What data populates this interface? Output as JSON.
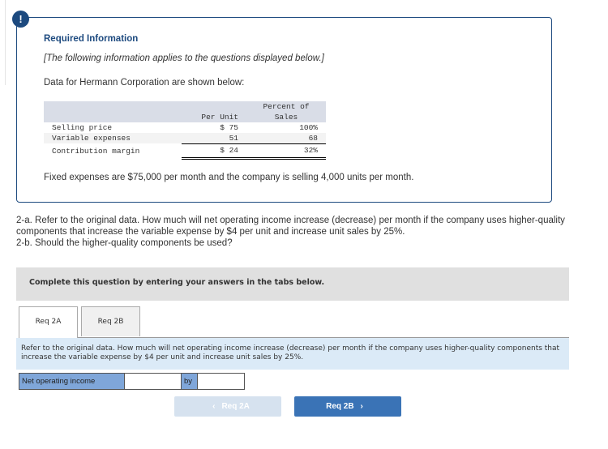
{
  "info": {
    "alert_icon": "!",
    "title": "Required Information",
    "note": "[The following information applies to the questions displayed below.]",
    "intro": "Data for Hermann Corporation are shown below:",
    "table": {
      "headers": {
        "per_unit": "Per Unit",
        "percent_line1": "Percent of",
        "percent_line2": "Sales"
      },
      "rows": [
        {
          "label": "Selling price",
          "per_unit": "$ 75",
          "percent": "100%"
        },
        {
          "label": "Variable expenses",
          "per_unit": "51",
          "percent": "68"
        },
        {
          "label": "Contribution margin",
          "per_unit": "$ 24",
          "percent": "32%"
        }
      ]
    },
    "fixed_note": "Fixed expenses are $75,000 per month and the company is selling 4,000 units per month."
  },
  "question": {
    "part_a": "2-a. Refer to the original data. How much will net operating income increase (decrease) per month if the company uses higher-quality components that increase the variable expense by $4 per unit and increase unit sales by 25%.",
    "part_b": "2-b. Should the higher-quality components be used?"
  },
  "instruction": "Complete this question by entering your answers in the tabs below.",
  "tabs": [
    {
      "label": "Req 2A",
      "active": true
    },
    {
      "label": "Req 2B",
      "active": false
    }
  ],
  "panel": {
    "text": "Refer to the original data. How much will net operating income increase (decrease) per month if the company uses higher-quality components that increase the variable expense by $4 per unit and increase unit sales by 25%.",
    "answer_label": "Net operating income",
    "answer_value": "",
    "by_label": "by",
    "amount_value": ""
  },
  "nav": {
    "prev_label": "Req 2A",
    "prev_icon": "‹",
    "next_label": "Req 2B",
    "next_icon": "›"
  }
}
